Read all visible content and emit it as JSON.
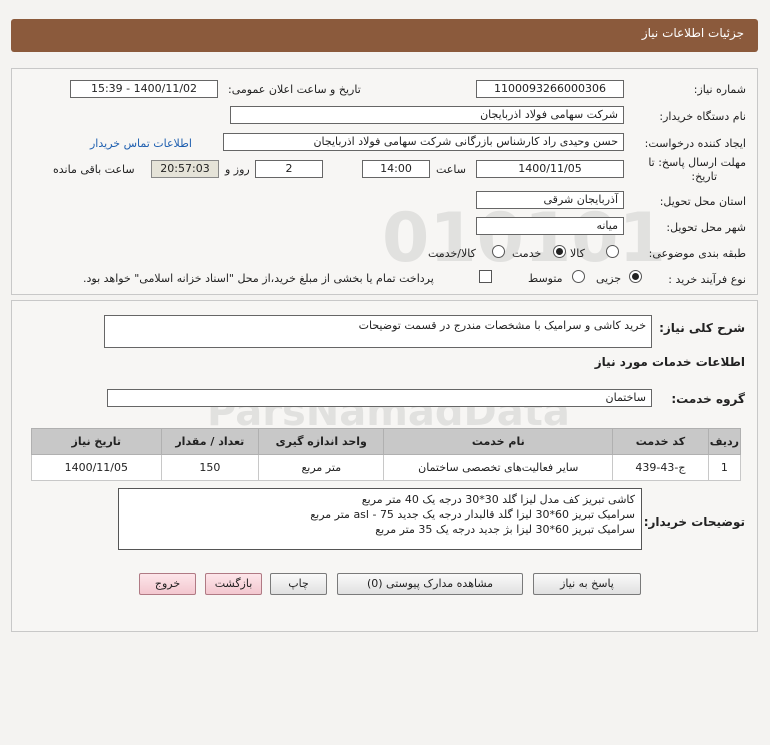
{
  "header": {
    "title": "جزئیات اطلاعات نیاز"
  },
  "form": {
    "need_number_label": "شماره نیاز:",
    "need_number": "1100093266000306",
    "announce_label": "تاریخ و ساعت اعلان عمومی:",
    "announce_value": "1400/11/02 - 15:39",
    "buyer_label": "نام دستگاه خریدار:",
    "buyer_value": "شرکت سهامی فولاد اذربایجان",
    "creator_label": "ایجاد کننده درخواست:",
    "creator_value": "حسن وحیدی راد کارشناس بازرگانی شرکت سهامی فولاد اذربایجان",
    "contact_link": "اطلاعات تماس خریدار",
    "deadline_label_1": "مهلت ارسال پاسخ: تا",
    "deadline_label_2": "تاریخ:",
    "deadline_date": "1400/11/05",
    "hour_label": "ساعت",
    "deadline_time": "14:00",
    "days_value": "2",
    "days_label": "روز و",
    "remaining_time": "20:57:03",
    "remaining_label": "ساعت باقی مانده",
    "province_label": "استان محل تحویل:",
    "province_value": "آذربایجان شرقی",
    "city_label": "شهر محل تحویل:",
    "city_value": "میانه",
    "category_label": "طبقه بندی موضوعی:",
    "category_options": [
      "کالا",
      "خدمت",
      "کالا/خدمت"
    ],
    "category_selected": "خدمت",
    "purchase_type_label": "نوع فرآیند خرید :",
    "purchase_options": [
      "جزیی",
      "متوسط"
    ],
    "purchase_selected": "جزیی",
    "payment_note": "پرداخت تمام یا بخشی از مبلغ خرید،از محل \"اسناد خزانه اسلامی\" خواهد بود."
  },
  "general_desc": {
    "label": "شرح کلی نیاز:",
    "value": "خرید کاشی و سرامیک با مشخصات مندرج در قسمت توضیحات"
  },
  "services_title": "اطلاعات خدمات مورد نیاز",
  "service_group": {
    "label": "گروه خدمت:",
    "value": "ساختمان"
  },
  "table": {
    "headers": [
      "ردیف",
      "کد خدمت",
      "نام خدمت",
      "واحد اندازه گیری",
      "تعداد / مقدار",
      "تاریخ نیاز"
    ],
    "rows": [
      [
        "1",
        "ج-43-439",
        "سایر فعالیت‌های تخصصی ساختمان",
        "متر مربع",
        "150",
        "1400/11/05"
      ]
    ]
  },
  "buyer_desc": {
    "label": "توضیحات خریدار:",
    "lines": [
      "کاشی تبریز کف مدل لیزا گلد 30*30 درجه یک 40 متر مربع",
      "سرامیک تبریز 60*30 لیزا گلد قالبدار درجه یک جدید 75 - asl متر مربع",
      "سرامیک تبریز 60*30 لیزا بژ جدید درجه یک 35 متر مربع"
    ]
  },
  "buttons": {
    "reply": "پاسخ به نیاز",
    "attachments": "مشاهده مدارک پیوستی (0)",
    "print": "چاپ",
    "back": "بازگشت",
    "exit": "خروج"
  },
  "colors": {
    "header_bg": "#8b5a3c",
    "link": "#2060b0",
    "table_header": "#c8c8c8"
  }
}
